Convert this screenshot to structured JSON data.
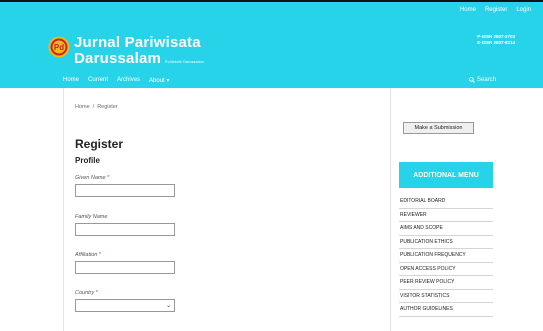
{
  "window_border_color": "#111111",
  "brand": {
    "accent": "#27d3e8",
    "logo_icon": "pd-logo-icon",
    "logo_letters": "Pd",
    "title_line1": "Jurnal Pariwisata",
    "title_line2": "Darussalam",
    "subtitle": "Politeknik Darussalam",
    "issn_print": "P-ISSN 2807-2703",
    "issn_online": "E-ISSN 2807-8214"
  },
  "top_links": [
    "Home",
    "Register",
    "Login"
  ],
  "nav": {
    "items": [
      "Home",
      "Current",
      "Archives",
      "About ▾"
    ],
    "search_label": "Search",
    "search_icon": "search-icon"
  },
  "breadcrumb": {
    "home": "Home",
    "separator": "/",
    "current": "Register"
  },
  "main": {
    "title": "Register",
    "section": "Profile",
    "required_marker": "*",
    "fields": [
      {
        "label": "Given Name",
        "required": true,
        "value": ""
      },
      {
        "label": "Family Name",
        "required": false,
        "value": ""
      },
      {
        "label": "Affiliation",
        "required": true,
        "value": ""
      },
      {
        "label": "Country",
        "required": true,
        "value": "",
        "type": "select",
        "caret": "⌄"
      }
    ]
  },
  "sidebar": {
    "submission_button": "Make a Submission",
    "menu_title": "ADDITIONAL MENU",
    "menu_items": [
      "EDITORIAL BOARD",
      "REVIEWER",
      "AIMS AND SCOPE",
      "PUBLICATION ETHICS",
      "PUBLICATION FREQUENCY",
      "OPEN ACCESS POLICY",
      "PEER REVIEW POLICY",
      "VISITOR STATISTICS",
      "AUTHOR GUIDELINES"
    ]
  }
}
